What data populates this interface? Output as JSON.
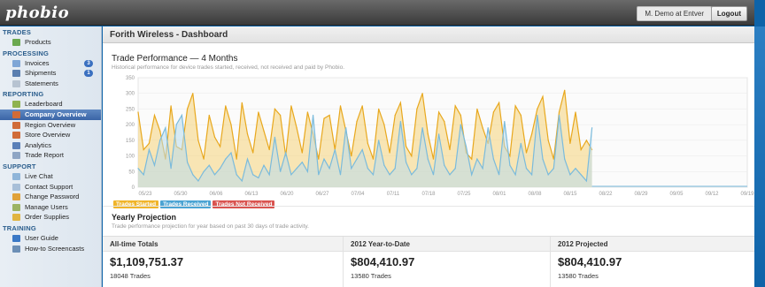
{
  "app": {
    "logo": "phobio",
    "user": "M. Demo at Entver",
    "logout": "Logout"
  },
  "page_title": "Forith Wireless - Dashboard",
  "sidebar": {
    "sections": [
      {
        "label": "TRADES",
        "items": [
          {
            "label": "Products",
            "icon": "box-icon",
            "color": "#6aa84f"
          }
        ]
      },
      {
        "label": "PROCESSING",
        "items": [
          {
            "label": "Invoices",
            "icon": "invoice-icon",
            "color": "#7fa6d6",
            "badge": "3"
          },
          {
            "label": "Shipments",
            "icon": "truck-icon",
            "color": "#5b7fb0",
            "badge": "1"
          },
          {
            "label": "Statements",
            "icon": "document-icon",
            "color": "#b7c3d1"
          }
        ]
      },
      {
        "label": "REPORTING",
        "items": [
          {
            "label": "Leaderboard",
            "icon": "leaderboard-icon",
            "color": "#8fb34f"
          },
          {
            "label": "Company Overview",
            "icon": "chart-line-icon",
            "color": "#d06b38",
            "active": true
          },
          {
            "label": "Region Overview",
            "icon": "chart-line-icon",
            "color": "#d06b38"
          },
          {
            "label": "Store Overview",
            "icon": "chart-line-icon",
            "color": "#d06b38"
          },
          {
            "label": "Analytics",
            "icon": "bar-chart-icon",
            "color": "#5a7fb8"
          },
          {
            "label": "Trade Report",
            "icon": "report-icon",
            "color": "#8ea5c4"
          }
        ]
      },
      {
        "label": "SUPPORT",
        "items": [
          {
            "label": "Live Chat",
            "icon": "chat-icon",
            "color": "#8fb5d9"
          },
          {
            "label": "Contact Support",
            "icon": "mail-icon",
            "color": "#a8bfd8"
          },
          {
            "label": "Change Password",
            "icon": "lock-icon",
            "color": "#e0a23a"
          },
          {
            "label": "Manage Users",
            "icon": "users-icon",
            "color": "#9bb363"
          },
          {
            "label": "Order Supplies",
            "icon": "supplies-icon",
            "color": "#e0b441"
          }
        ]
      },
      {
        "label": "TRAINING",
        "items": [
          {
            "label": "User Guide",
            "icon": "info-icon",
            "color": "#3a78c6"
          },
          {
            "label": "How-to Screencasts",
            "icon": "video-icon",
            "color": "#6c8fb6"
          }
        ]
      }
    ]
  },
  "chart_section": {
    "title": "Trade Performance — 4 Months",
    "subtitle": "Historical performance for device trades started, received, not received and paid by Phobio."
  },
  "chart_data": {
    "type": "area",
    "ylim": [
      0,
      350
    ],
    "yticks": [
      0,
      50,
      100,
      150,
      200,
      250,
      300,
      350
    ],
    "xticks": [
      "05/23",
      "05/30",
      "06/06",
      "06/13",
      "06/20",
      "06/27",
      "07/04",
      "07/11",
      "07/18",
      "07/25",
      "08/01",
      "08/08",
      "08/15",
      "08/22",
      "08/29",
      "09/05",
      "09/12",
      "09/19"
    ],
    "colors": {
      "started": "#f0b429",
      "received": "#8fc4e0",
      "not_received": "#d9534f"
    },
    "series": [
      {
        "name": "Trades Started",
        "values": [
          240,
          120,
          140,
          230,
          180,
          90,
          260,
          130,
          120,
          250,
          300,
          150,
          90,
          230,
          160,
          130,
          260,
          200,
          90,
          270,
          170,
          110,
          240,
          180,
          120,
          250,
          230,
          100,
          260,
          190,
          110,
          240,
          170,
          90,
          220,
          230,
          120,
          260,
          180,
          100,
          210,
          260,
          140,
          90,
          250,
          200,
          110,
          230,
          270,
          130,
          100,
          250,
          300,
          170,
          90,
          240,
          210,
          120,
          260,
          230,
          110,
          90,
          250,
          190,
          140,
          240,
          270,
          130,
          100,
          260,
          230,
          110,
          170,
          250,
          290,
          150,
          90,
          240,
          310,
          140,
          240,
          120,
          150,
          120
        ]
      },
      {
        "name": "Trades Received",
        "values": [
          60,
          40,
          120,
          70,
          150,
          190,
          60,
          200,
          230,
          80,
          40,
          20,
          50,
          70,
          40,
          60,
          90,
          110,
          40,
          20,
          90,
          40,
          30,
          70,
          40,
          160,
          50,
          110,
          40,
          60,
          80,
          50,
          230,
          40,
          90,
          60,
          120,
          40,
          190,
          60,
          90,
          120,
          60,
          40,
          150,
          70,
          40,
          60,
          210,
          80,
          40,
          60,
          190,
          90,
          40,
          170,
          70,
          40,
          60,
          200,
          130,
          40,
          90,
          60,
          190,
          90,
          40,
          210,
          70,
          40,
          140,
          60,
          40,
          230,
          90,
          40,
          60,
          230,
          90,
          40,
          60,
          40,
          20,
          190
        ]
      },
      {
        "name": "Trades Not Received",
        "values": []
      }
    ]
  },
  "legend": [
    "Trades Started",
    "Trades Received",
    "Trades Not Received"
  ],
  "projection": {
    "title": "Yearly Projection",
    "subtitle": "Trade performance projection for year based on past 30 days of trade activity.",
    "columns": [
      {
        "header": "All-time Totals",
        "amount": "$1,109,751.37",
        "trades": "18048 Trades"
      },
      {
        "header": "2012 Year-to-Date",
        "amount": "$804,410.97",
        "trades": "13580 Trades"
      },
      {
        "header": "2012 Projected",
        "amount": "$804,410.97",
        "trades": "13580 Trades"
      }
    ]
  }
}
